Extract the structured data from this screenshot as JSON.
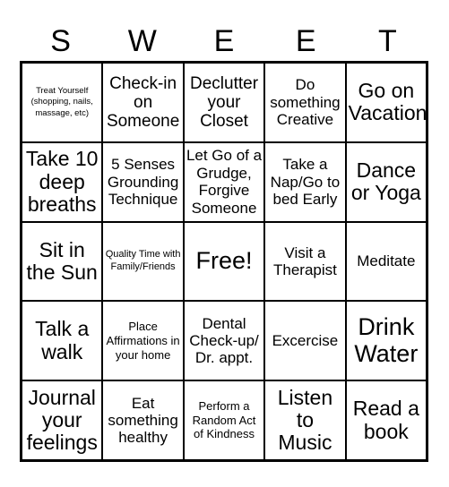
{
  "card": {
    "title_letters": [
      "S",
      "W",
      "E",
      "E",
      "T"
    ],
    "columns": 5,
    "rows": 5,
    "border_color": "#000000",
    "background_color": "#ffffff",
    "text_color": "#000000"
  },
  "grid": {
    "rows": [
      {
        "cells": [
          {
            "text": "Treat Yourself (shopping, nails, massage, etc)",
            "size": "xxs"
          },
          {
            "text": "Check-in on Someone",
            "size": "lg"
          },
          {
            "text": "Declutter your Closet",
            "size": "lg"
          },
          {
            "text": "Do something Creative",
            "size": "md"
          },
          {
            "text": "Go on Vacation",
            "size": "xl"
          }
        ]
      },
      {
        "cells": [
          {
            "text": "Take 10 deep breaths",
            "size": "xl"
          },
          {
            "text": "5 Senses Grounding Technique",
            "size": "md"
          },
          {
            "text": "Let Go of a Grudge, Forgive Someone",
            "size": "md"
          },
          {
            "text": "Take a Nap/Go to bed Early",
            "size": "md"
          },
          {
            "text": "Dance or Yoga",
            "size": "xl"
          }
        ]
      },
      {
        "cells": [
          {
            "text": "Sit in the Sun",
            "size": "xl"
          },
          {
            "text": "Quality Time with Family/Friends",
            "size": "xs"
          },
          {
            "text": "Free!",
            "size": "xxl"
          },
          {
            "text": "Visit a Therapist",
            "size": "md"
          },
          {
            "text": "Meditate",
            "size": "md"
          }
        ]
      },
      {
        "cells": [
          {
            "text": "Talk a walk",
            "size": "xl"
          },
          {
            "text": "Place Affirmations in your home",
            "size": "sm"
          },
          {
            "text": "Dental Check-up/ Dr. appt.",
            "size": "md"
          },
          {
            "text": "Excercise",
            "size": "md"
          },
          {
            "text": "Drink Water",
            "size": "xxl"
          }
        ]
      },
      {
        "cells": [
          {
            "text": "Journal your feelings",
            "size": "xl"
          },
          {
            "text": "Eat something healthy",
            "size": "md"
          },
          {
            "text": "Perform a Random Act of Kindness",
            "size": "sm"
          },
          {
            "text": "Listen to Music",
            "size": "xl"
          },
          {
            "text": "Read a book",
            "size": "xl"
          }
        ]
      }
    ]
  }
}
